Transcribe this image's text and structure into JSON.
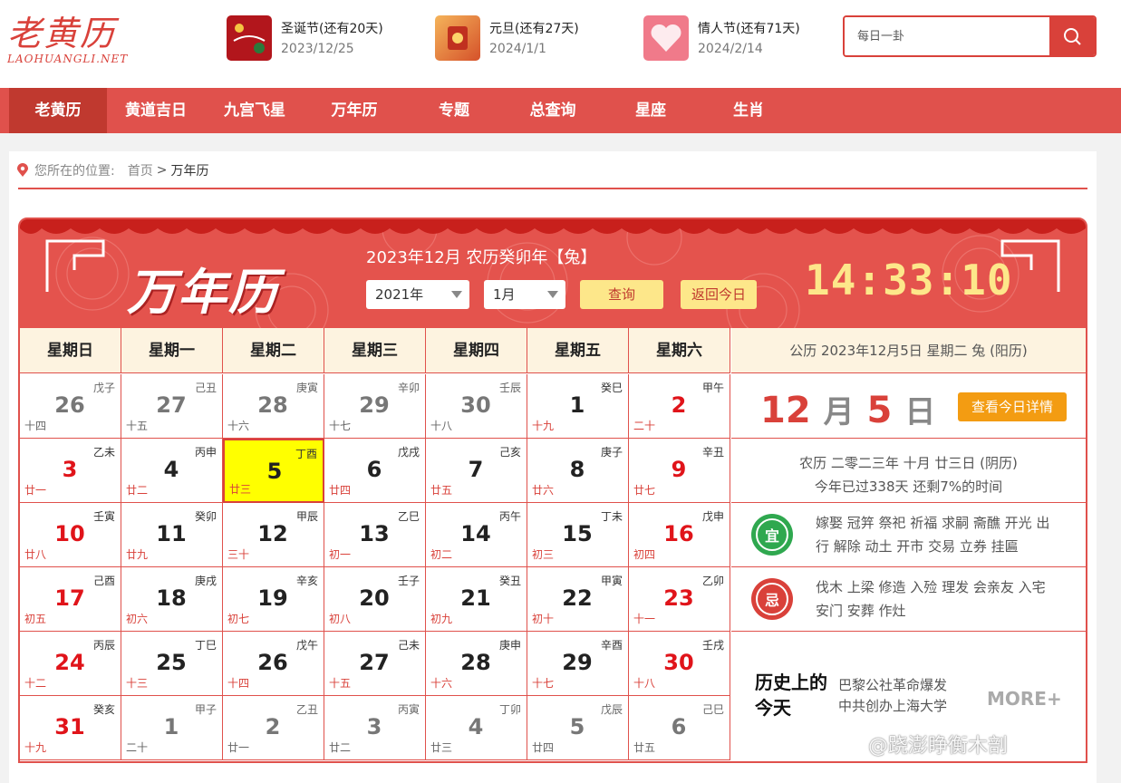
{
  "logo": {
    "cn": "老黄历",
    "en": "LAOHUANGLI.NET"
  },
  "holidays": [
    {
      "name": "圣诞节(还有20天)",
      "date": "2023/12/25",
      "color": "#b2161c"
    },
    {
      "name": "元旦(还有27天)",
      "date": "2024/1/1",
      "color": "#e8853a"
    },
    {
      "name": "情人节(还有71天)",
      "date": "2024/2/14",
      "color": "#e85a6a"
    }
  ],
  "search": {
    "placeholder": "每日一卦"
  },
  "nav": [
    "老黄历",
    "黄道吉日",
    "九宫飞星",
    "万年历",
    "专题",
    "总查询",
    "星座",
    "生肖"
  ],
  "breadcrumb": {
    "prefix": "您所在的位置:",
    "home": "首页",
    "sep": ">",
    "current": "万年历"
  },
  "calendar": {
    "banner_title": "万年历",
    "month_title": "2023年12月 农历癸卯年【兔】",
    "year_select": "2021年",
    "month_select": "1月",
    "query_label": "查询",
    "today_label": "返回今日",
    "clock": "14:33:10",
    "weekdays": [
      "星期日",
      "星期一",
      "星期二",
      "星期三",
      "星期四",
      "星期五",
      "星期六"
    ],
    "weeks": [
      [
        [
          "26",
          "戊子",
          "十四",
          1,
          0
        ],
        [
          "27",
          "己丑",
          "十五",
          1,
          0
        ],
        [
          "28",
          "庚寅",
          "十六",
          1,
          0
        ],
        [
          "29",
          "辛卯",
          "十七",
          1,
          0
        ],
        [
          "30",
          "壬辰",
          "十八",
          1,
          0
        ],
        [
          "1",
          "癸巳",
          "十九",
          0,
          1
        ],
        [
          "2",
          "甲午",
          "二十",
          0,
          1
        ]
      ],
      [
        [
          "3",
          "乙未",
          "廿一",
          0,
          1
        ],
        [
          "4",
          "丙申",
          "廿二",
          0,
          1
        ],
        [
          "5",
          "丁酉",
          "廿三",
          0,
          1
        ],
        [
          "6",
          "戊戌",
          "廿四",
          0,
          1
        ],
        [
          "7",
          "己亥",
          "廿五",
          0,
          1
        ],
        [
          "8",
          "庚子",
          "廿六",
          0,
          1
        ],
        [
          "9",
          "辛丑",
          "廿七",
          0,
          1
        ]
      ],
      [
        [
          "10",
          "壬寅",
          "廿八",
          0,
          1
        ],
        [
          "11",
          "癸卯",
          "廿九",
          0,
          1
        ],
        [
          "12",
          "甲辰",
          "三十",
          0,
          1
        ],
        [
          "13",
          "乙巳",
          "初一",
          0,
          1
        ],
        [
          "14",
          "丙午",
          "初二",
          0,
          1
        ],
        [
          "15",
          "丁未",
          "初三",
          0,
          1
        ],
        [
          "16",
          "戊申",
          "初四",
          0,
          1
        ]
      ],
      [
        [
          "17",
          "己酉",
          "初五",
          0,
          1
        ],
        [
          "18",
          "庚戌",
          "初六",
          0,
          1
        ],
        [
          "19",
          "辛亥",
          "初七",
          0,
          1
        ],
        [
          "20",
          "壬子",
          "初八",
          0,
          1
        ],
        [
          "21",
          "癸丑",
          "初九",
          0,
          1
        ],
        [
          "22",
          "甲寅",
          "初十",
          0,
          1
        ],
        [
          "23",
          "乙卯",
          "十一",
          0,
          1
        ]
      ],
      [
        [
          "24",
          "丙辰",
          "十二",
          0,
          1
        ],
        [
          "25",
          "丁巳",
          "十三",
          0,
          1
        ],
        [
          "26",
          "戊午",
          "十四",
          0,
          1
        ],
        [
          "27",
          "己未",
          "十五",
          0,
          1
        ],
        [
          "28",
          "庚申",
          "十六",
          0,
          1
        ],
        [
          "29",
          "辛酉",
          "十七",
          0,
          1
        ],
        [
          "30",
          "壬戌",
          "十八",
          0,
          1
        ]
      ],
      [
        [
          "31",
          "癸亥",
          "十九",
          0,
          1
        ],
        [
          "1",
          "甲子",
          "二十",
          1,
          0
        ],
        [
          "2",
          "乙丑",
          "廿一",
          1,
          0
        ],
        [
          "3",
          "丙寅",
          "廿二",
          1,
          0
        ],
        [
          "4",
          "丁卯",
          "廿三",
          1,
          0
        ],
        [
          "5",
          "戊辰",
          "廿四",
          1,
          0
        ],
        [
          "6",
          "己巳",
          "廿五",
          1,
          0
        ]
      ]
    ]
  },
  "today_panel": {
    "solar_header": "公历 2023年12月5日 星期二 兔 (阳历)",
    "month": "12",
    "month_unit": "月",
    "day": "5",
    "day_unit": "日",
    "detail_label": "查看今日详情",
    "lunar": "农历 二零二三年 十月 廿三日 (阴历)",
    "progress": "今年已过338天 还剩7%的时间",
    "yi_label": "宜",
    "yi": "嫁娶 冠笄 祭祀 祈福 求嗣 斋醮 开光 出行 解除 动土 开市 交易 立券 挂匾",
    "ji_label": "忌",
    "ji": "伐木 上梁 修造 入殓 理发 会亲友 入宅 安门 安葬 作灶",
    "history_title": "历史上的今天",
    "history_items": [
      "巴黎公社革命爆发",
      "中共创办上海大学"
    ],
    "more": "MORE+"
  },
  "watermark": "@跷澎睁衡木剖",
  "colors": {
    "brand": "#e0514c",
    "today_cell": "#ffff00",
    "weekend": "#e0141a",
    "yi": "#2fa84f",
    "ji": "#d9413a",
    "button_yellow": "#fde78a",
    "detail_orange": "#f39c12"
  }
}
